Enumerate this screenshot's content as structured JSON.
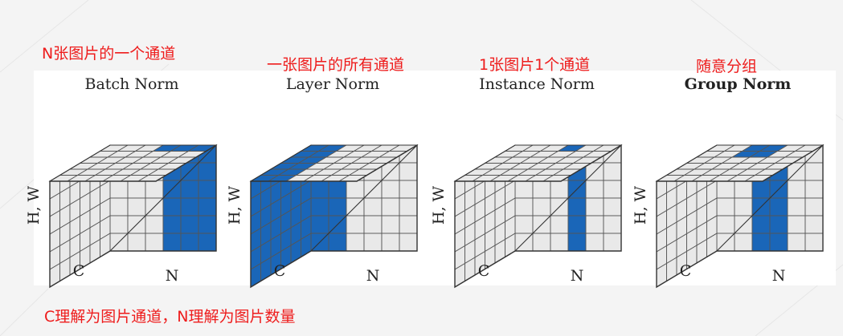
{
  "annotations": {
    "top": [
      "N张图片的一个通道",
      "一张图片的所有通道",
      "1张图片1个通道",
      "随意分组"
    ],
    "bottom": "C理解为图片通道，N理解为图片数量"
  },
  "cubes": [
    {
      "title": "Batch Norm",
      "bold": false,
      "axis_labels": {
        "side": "H, W",
        "c": "C",
        "n": "N"
      }
    },
    {
      "title": "Layer Norm",
      "bold": false,
      "axis_labels": {
        "side": "H, W",
        "c": "C",
        "n": "N"
      }
    },
    {
      "title": "Instance Norm",
      "bold": false,
      "axis_labels": {
        "side": "H, W",
        "c": "C",
        "n": "N"
      }
    },
    {
      "title": "Group Norm",
      "bold": true,
      "axis_labels": {
        "side": "H, W",
        "c": "C",
        "n": "N"
      }
    }
  ],
  "colors": {
    "highlight": "#1a66b8",
    "cell": "#e9e9e9",
    "grid_line": "#555555",
    "annotation": "#ee1c1c"
  }
}
